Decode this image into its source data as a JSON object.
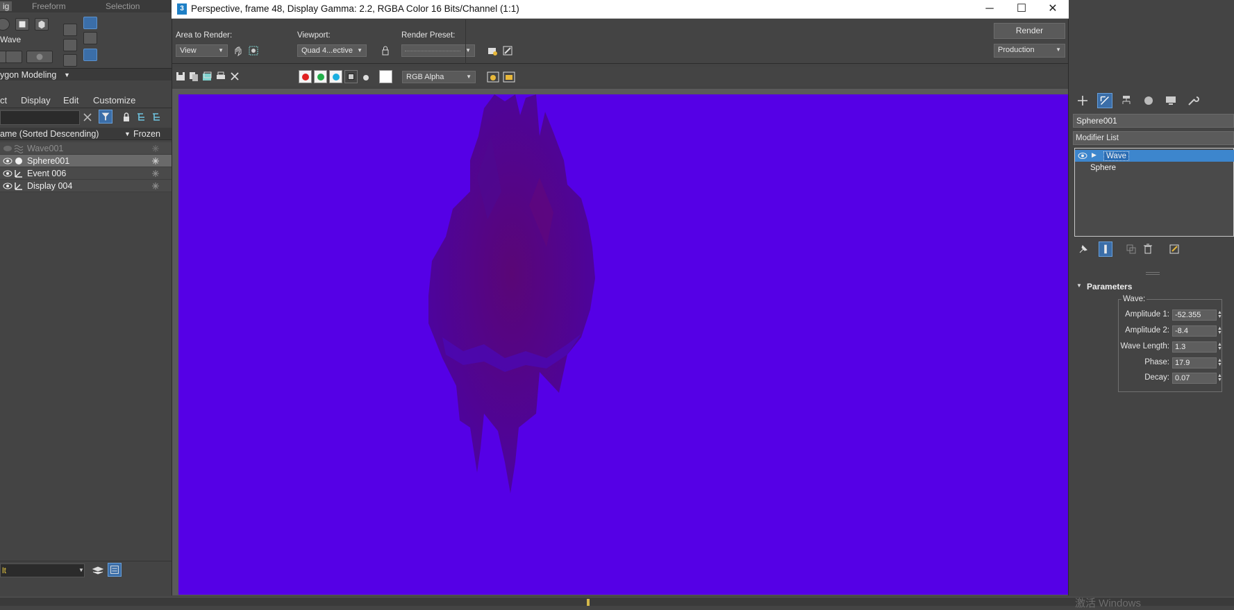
{
  "app": {
    "ribbon_tabs": [
      "ig",
      "Freeform",
      "Selection"
    ],
    "ribbon_label": "Wave",
    "poly_modeling_label": "ygon Modeling"
  },
  "scene_explorer": {
    "menu": [
      "ct",
      "Display",
      "Edit",
      "Customize"
    ],
    "col_name": "ame (Sorted Descending)",
    "col_frozen": "Frozen",
    "rows": [
      {
        "name": "Wave001",
        "dim": true,
        "selected": false
      },
      {
        "name": "Sphere001",
        "dim": false,
        "selected": true
      },
      {
        "name": "Event 006",
        "dim": false,
        "selected": false
      },
      {
        "name": "Display 004",
        "dim": false,
        "selected": false
      }
    ],
    "layer_value": "lt"
  },
  "render_dialog": {
    "title": "Perspective, frame 48, Display Gamma: 2.2, RGBA Color 16 Bits/Channel (1:1)",
    "area_label": "Area to Render:",
    "area_value": "View",
    "viewport_label": "Viewport:",
    "viewport_value": "Quad 4...ective",
    "preset_label": "Render Preset:",
    "preset_value": "",
    "render_button": "Render",
    "production_value": "Production",
    "channel_value": "RGB Alpha",
    "background_color": "#5500e6",
    "object_color": "#5c0a7a"
  },
  "command_panel": {
    "object_name": "Sphere001",
    "modifier_list": "Modifier List",
    "stack": [
      "Wave",
      "Sphere"
    ],
    "rollout_title": "Parameters",
    "group_title": "Wave:",
    "params": [
      {
        "label": "Amplitude 1:",
        "value": "-52.355"
      },
      {
        "label": "Amplitude 2:",
        "value": "-8.4"
      },
      {
        "label": "Wave Length:",
        "value": "1.3"
      },
      {
        "label": "Phase:",
        "value": "17.9"
      },
      {
        "label": "Decay:",
        "value": "0.07"
      }
    ]
  },
  "watermark": "激活 Windows"
}
